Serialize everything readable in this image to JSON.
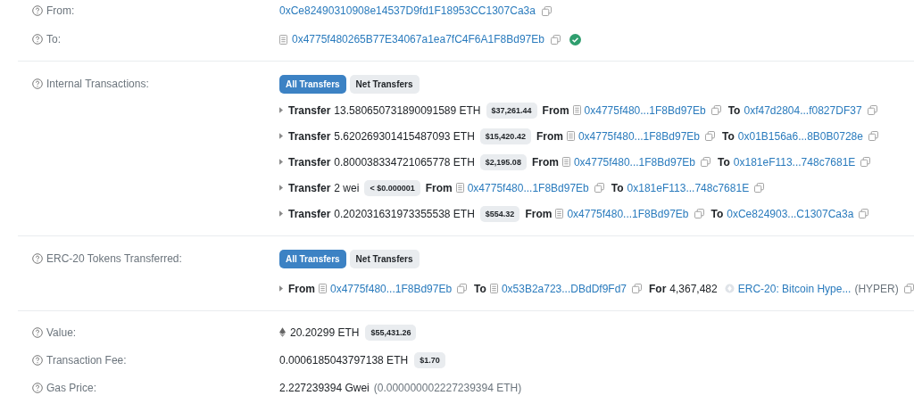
{
  "from": {
    "label": "From:",
    "address": "0xCe82490310908e14537D9fd1F18953CC1307Ca3a",
    "contract": false
  },
  "to": {
    "label": "To:",
    "address": "0x4775f480265B77E34067a1ea7fC4F6A1F8Bd97Eb",
    "contract": true,
    "verified": true
  },
  "internal_transactions": {
    "label": "Internal Transactions:",
    "tabs": [
      {
        "label": "All Transfers",
        "selected": true
      },
      {
        "label": "Net Transfers",
        "selected": false
      }
    ],
    "transfers": [
      {
        "word": "Transfer",
        "amount": "13.580650731890091589 ETH",
        "usd": "$37,261.44",
        "from_word": "From",
        "from": "0x4775f480...1F8Bd97Eb",
        "from_contract": true,
        "to_word": "To",
        "to": "0xf47d2804...f0827DF37",
        "to_contract": false
      },
      {
        "word": "Transfer",
        "amount": "5.620269301415487093 ETH",
        "usd": "$15,420.42",
        "from_word": "From",
        "from": "0x4775f480...1F8Bd97Eb",
        "from_contract": true,
        "to_word": "To",
        "to": "0x01B156a6...8B0B0728e",
        "to_contract": false
      },
      {
        "word": "Transfer",
        "amount": "0.800038334721065778 ETH",
        "usd": "$2,195.08",
        "from_word": "From",
        "from": "0x4775f480...1F8Bd97Eb",
        "from_contract": true,
        "to_word": "To",
        "to": "0x181eF113...748c7681E",
        "to_contract": false
      },
      {
        "word": "Transfer",
        "amount": "2 wei",
        "usd": "< $0.000001",
        "from_word": "From",
        "from": "0x4775f480...1F8Bd97Eb",
        "from_contract": true,
        "to_word": "To",
        "to": "0x181eF113...748c7681E",
        "to_contract": false
      },
      {
        "word": "Transfer",
        "amount": "0.202031631973355538 ETH",
        "usd": "$554.32",
        "from_word": "From",
        "from": "0x4775f480...1F8Bd97Eb",
        "from_contract": true,
        "to_word": "To",
        "to": "0xCe824903...C1307Ca3a",
        "to_contract": false
      }
    ]
  },
  "erc20_tokens_transferred": {
    "label": "ERC-20 Tokens Transferred:",
    "tabs": [
      {
        "label": "All Transfers",
        "selected": true
      },
      {
        "label": "Net Transfers",
        "selected": false
      }
    ],
    "transfers": [
      {
        "from_word": "From",
        "from": "0x4775f480...1F8Bd97Eb",
        "from_contract": true,
        "to_word": "To",
        "to": "0x53B2a723...DBdDf9Fd7",
        "to_contract": true,
        "for_word": "For",
        "amount": "4,367,482",
        "token": "ERC-20: Bitcoin Hype...",
        "symbol": "(HYPER)"
      }
    ]
  },
  "value": {
    "label": "Value:",
    "amount": "20.20299 ETH",
    "usd": "$55,431.26"
  },
  "transaction_fee": {
    "label": "Transaction Fee:",
    "amount": "0.0006185043797138 ETH",
    "usd": "$1.70"
  },
  "gas_price": {
    "label": "Gas Price:",
    "amount": "2.227239394 Gwei",
    "eth": "(0.000000002227239394 ETH)"
  }
}
